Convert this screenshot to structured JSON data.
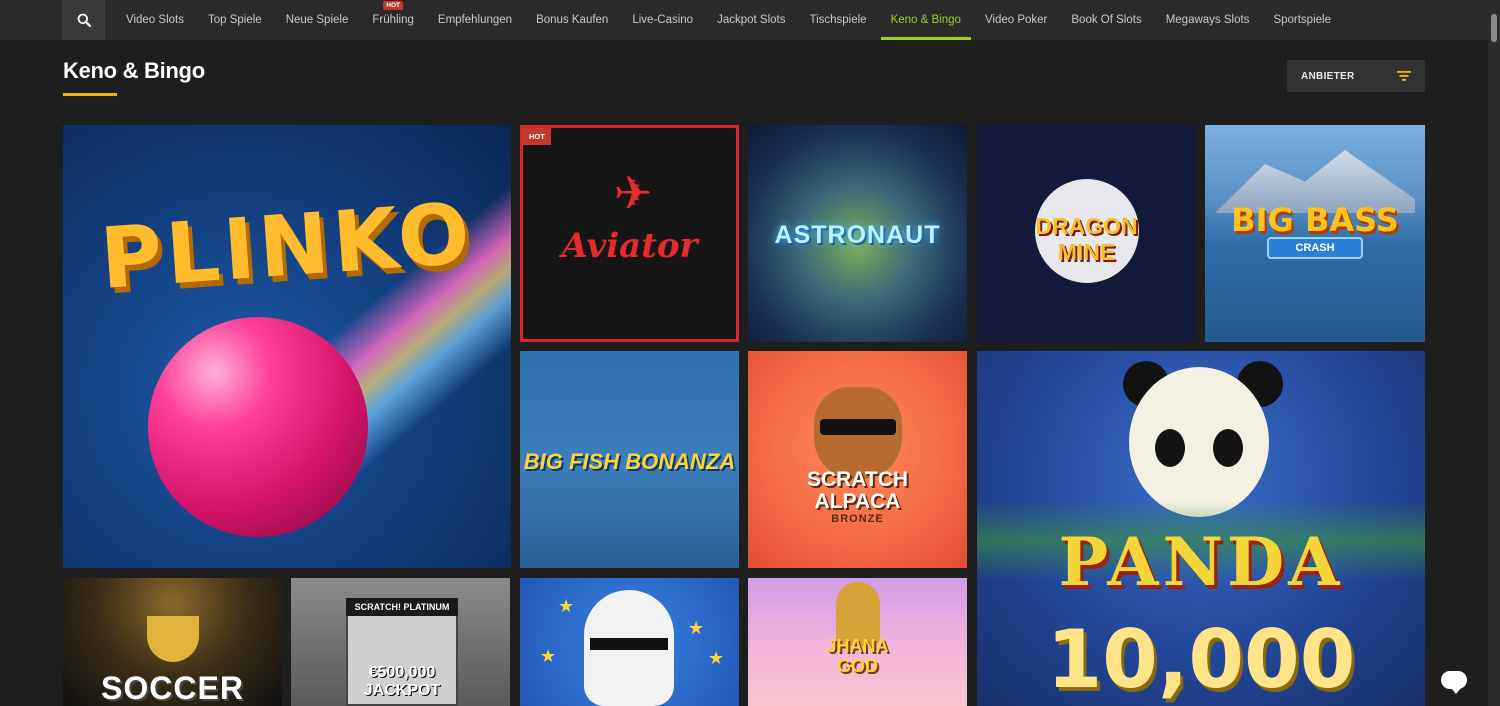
{
  "nav": {
    "items": [
      {
        "label": "Video Slots"
      },
      {
        "label": "Top Spiele"
      },
      {
        "label": "Neue Spiele"
      },
      {
        "label": "Frühling",
        "tag": "HOT"
      },
      {
        "label": "Empfehlungen"
      },
      {
        "label": "Bonus Kaufen"
      },
      {
        "label": "Live-Casino"
      },
      {
        "label": "Jackpot Slots"
      },
      {
        "label": "Tischspiele"
      },
      {
        "label": "Keno & Bingo",
        "active": true
      },
      {
        "label": "Video Poker"
      },
      {
        "label": "Book Of Slots"
      },
      {
        "label": "Megaways Slots"
      },
      {
        "label": "Sportspiele"
      }
    ],
    "active_color": "#9bd12a"
  },
  "header": {
    "title": "Keno & Bingo",
    "accent_color": "#f2b705",
    "filter_label": "ANBIETER"
  },
  "games": {
    "plinko": {
      "title": "PLINKO"
    },
    "aviator": {
      "title": "Aviator",
      "badge": "HOT"
    },
    "astronaut": {
      "title": "ASTRONAUT"
    },
    "dragon_mine": {
      "title_line1": "DRAGON",
      "title_line2": "MINE"
    },
    "big_bass_crash": {
      "title": "BIG BASS",
      "subtitle": "CRASH"
    },
    "big_fish_bonanza": {
      "title": "BIG FISH BONANZA"
    },
    "scratch_alpaca": {
      "title_line1": "SCRATCH",
      "title_line2": "ALPACA",
      "subtitle": "BRONZE"
    },
    "panda": {
      "title": "PANDA",
      "number": "10,000"
    },
    "soccer": {
      "title": "SOCCER"
    },
    "scratch_platinum": {
      "title": "SCRATCH! PLATINUM",
      "prize": "€500,000",
      "prize_label": "JACKPOT"
    },
    "llama": {},
    "buddha": {
      "title_line1": "JHANA",
      "title_line2": "GOD"
    }
  },
  "icons": {
    "search": "search-icon",
    "filter": "filter-icon",
    "chat": "chat-icon"
  },
  "colors": {
    "hot_badge": "#c0392b",
    "filter_icon": "#f2b705"
  }
}
